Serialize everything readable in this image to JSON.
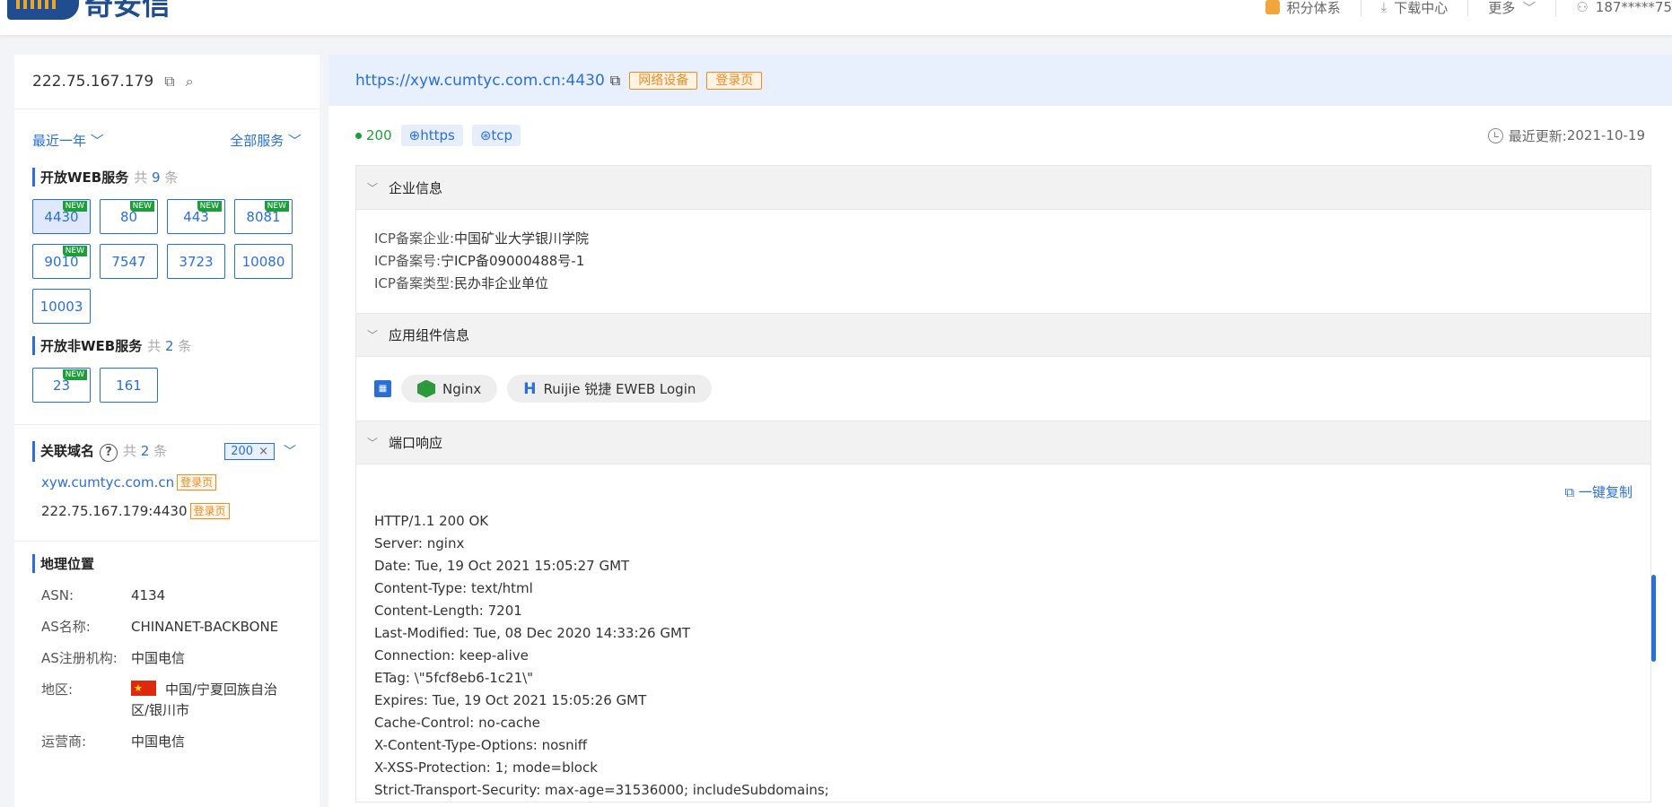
{
  "brand": {
    "name": "奇安信"
  },
  "topnav": {
    "points": "积分体系",
    "download": "下载中心",
    "more": "更多",
    "user": "187*****75"
  },
  "left": {
    "ip": "222.75.167.179",
    "time_filter": "最近一年",
    "service_filter": "全部服务",
    "web_services": {
      "title": "开放WEB服务",
      "count_prefix": "共",
      "count": "9",
      "count_suffix": "条",
      "ports": [
        {
          "port": "4430",
          "new": true,
          "active": true
        },
        {
          "port": "80",
          "new": true
        },
        {
          "port": "443",
          "new": true
        },
        {
          "port": "8081",
          "new": true
        },
        {
          "port": "9010",
          "new": true
        },
        {
          "port": "7547",
          "new": false
        },
        {
          "port": "3723",
          "new": false
        },
        {
          "port": "10080",
          "new": false
        },
        {
          "port": "10003",
          "new": false
        }
      ]
    },
    "non_web_services": {
      "title": "开放非WEB服务",
      "count_prefix": "共",
      "count": "2",
      "count_suffix": "条",
      "ports": [
        {
          "port": "23",
          "new": true
        },
        {
          "port": "161",
          "new": false
        }
      ]
    },
    "new_label": "NEW",
    "related_domains": {
      "title": "关联域名",
      "help": "?",
      "count_prefix": "共",
      "count": "2",
      "count_suffix": "条",
      "filter_chip": "200",
      "items": [
        {
          "text": "xyw.cumtyc.com.cn",
          "tag": "登录页",
          "link": true
        },
        {
          "text": "222.75.167.179:4430",
          "tag": "登录页",
          "link": false
        }
      ]
    },
    "geo": {
      "title": "地理位置",
      "rows": [
        {
          "k": "ASN:",
          "v": "4134"
        },
        {
          "k": "AS名称:",
          "v": "CHINANET-BACKBONE"
        },
        {
          "k": "AS注册机构:",
          "v": "中国电信"
        },
        {
          "k": "地区:",
          "v": "中国/宁夏回族自治区/银川市",
          "flag": true
        },
        {
          "k": "运营商:",
          "v": "中国电信"
        }
      ]
    }
  },
  "right": {
    "url": "https://xyw.cumtyc.com.cn:4430",
    "tags": [
      "网络设备",
      "登录页"
    ],
    "status_code": "200",
    "protocols": [
      "https",
      "tcp"
    ],
    "updated_label": "最近更新:",
    "updated_date": "2021-10-19",
    "enterprise": {
      "title": "企业信息",
      "rows": [
        {
          "k": "ICP备案企业:",
          "v": "中国矿业大学银川学院"
        },
        {
          "k": "ICP备案号:",
          "v": "宁ICP备09000488号-1"
        },
        {
          "k": "ICP备案类型:",
          "v": "民办非企业单位"
        }
      ]
    },
    "components": {
      "title": "应用组件信息",
      "items": [
        "Nginx",
        "Ruijie 锐捷 EWEB Login"
      ]
    },
    "port_response": {
      "title": "端口响应",
      "copy_label": "一键复制",
      "lines": [
        "HTTP/1.1 200 OK",
        "Server: nginx",
        "Date: Tue, 19 Oct 2021 15:05:27 GMT",
        "Content-Type: text/html",
        "Content-Length: 7201",
        "Last-Modified: Tue, 08 Dec 2020 14:33:26 GMT",
        "Connection: keep-alive",
        "ETag: \\\"5fcf8eb6-1c21\\\"",
        "Expires: Tue, 19 Oct 2021 15:05:26 GMT",
        "Cache-Control: no-cache",
        "X-Content-Type-Options: nosniff",
        "X-XSS-Protection: 1; mode=block",
        "Strict-Transport-Security: max-age=31536000; includeSubdomains;"
      ]
    }
  }
}
